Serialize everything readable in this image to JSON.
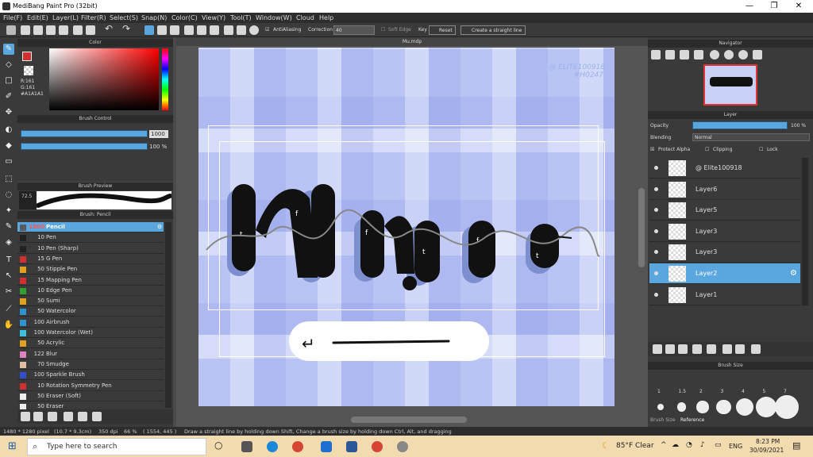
{
  "window": {
    "title": "MediBang Paint Pro (32bit)",
    "min": "—",
    "max": "❐",
    "close": "✕"
  },
  "menu": [
    "File(F)",
    "Edit(E)",
    "Layer(L)",
    "Filter(R)",
    "Select(S)",
    "Snap(N)",
    "Color(C)",
    "View(Y)",
    "Tool(T)",
    "Window(W)",
    "Cloud",
    "Help"
  ],
  "toolbar": {
    "antialiasing": "AntiAliasing",
    "correction_label": "Correction",
    "correction_value": "40",
    "soft_edge": "Soft Edge",
    "key": "Key",
    "reset": "Reset",
    "straight_line": "Create a straight line"
  },
  "color_panel": {
    "title": "Color",
    "r": "R:161",
    "g": "G:161",
    "hex": "#A1A1A1"
  },
  "brush_control": {
    "title": "Brush Control",
    "size": "1000",
    "opacity": "100 %",
    "size_fraction": 1.0,
    "opacity_fraction": 1.0
  },
  "brush_preview": {
    "title": "Brush Preview",
    "size_label": "72.5"
  },
  "brush_list": {
    "title": "Brush: Pencil",
    "items": [
      {
        "size": "1000",
        "name": "Pencil",
        "color": "#5a5a5a"
      },
      {
        "size": "10",
        "name": "Pen",
        "color": "#222222"
      },
      {
        "size": "10",
        "name": "Pen (Sharp)",
        "color": "#222222"
      },
      {
        "size": "15",
        "name": "G Pen",
        "color": "#d23030"
      },
      {
        "size": "50",
        "name": "Stipple Pen",
        "color": "#e0a020"
      },
      {
        "size": "15",
        "name": "Mapping Pen",
        "color": "#d23030"
      },
      {
        "size": "10",
        "name": "Edge Pen",
        "color": "#30a030"
      },
      {
        "size": "50",
        "name": "Sumi",
        "color": "#e0a020"
      },
      {
        "size": "50",
        "name": "Watercolor",
        "color": "#3090d0"
      },
      {
        "size": "100",
        "name": "Airbrush",
        "color": "#3090d0"
      },
      {
        "size": "100",
        "name": "Watercolor (Wet)",
        "color": "#40c0e0"
      },
      {
        "size": "50",
        "name": "Acrylic",
        "color": "#e0a020"
      },
      {
        "size": "122",
        "name": "Blur",
        "color": "#e080c0"
      },
      {
        "size": "70",
        "name": "Smudge",
        "color": "#e0c0a0"
      },
      {
        "size": "100",
        "name": "Sparkle Brush",
        "color": "#3050d0"
      },
      {
        "size": "10",
        "name": "Rotation Symmetry Pen",
        "color": "#d23030"
      },
      {
        "size": "50",
        "name": "Eraser (Soft)",
        "color": "#eeeeee"
      },
      {
        "size": "50",
        "name": "Eraser",
        "color": "#eeeeee"
      }
    ]
  },
  "canvas": {
    "tab": "Mu.mdp",
    "watermark_line1": "@ ELITE100918",
    "watermark_line2": "#H0247"
  },
  "navigator": {
    "title": "Navigator"
  },
  "layer_panel": {
    "title": "Layer",
    "opacity_label": "Opacity",
    "opacity_value": "100 %",
    "blending_label": "Blending",
    "blending_value": "Normal",
    "protect_alpha": "Protect Alpha",
    "clipping": "Clipping",
    "lock": "Lock",
    "layers": [
      "@ Elite100918",
      "Layer6",
      "Layer5",
      "Layer3",
      "Layer3",
      "Layer2",
      "Layer1"
    ],
    "selected": 5
  },
  "brush_size_panel": {
    "title": "Brush Size",
    "sizes": [
      "1",
      "1.5",
      "2",
      "3",
      "4",
      "5",
      "7"
    ],
    "tab1": "Brush Size",
    "tab2": "Reference"
  },
  "status": {
    "dims": "1480 * 1280 pixel",
    "cm": "(10.7 * 9.3cm)",
    "dpi": "350 dpi",
    "zoom": "66 %",
    "coords": "( 1554, 445 )",
    "hint": "Draw a straight line by holding down Shift, Change a brush size by holding down Ctrl, Alt, and dragging"
  },
  "taskbar": {
    "search": "Type here to search",
    "weather": "85°F Clear",
    "lang": "ENG",
    "time": "8:23 PM",
    "date": "30/09/2021"
  }
}
